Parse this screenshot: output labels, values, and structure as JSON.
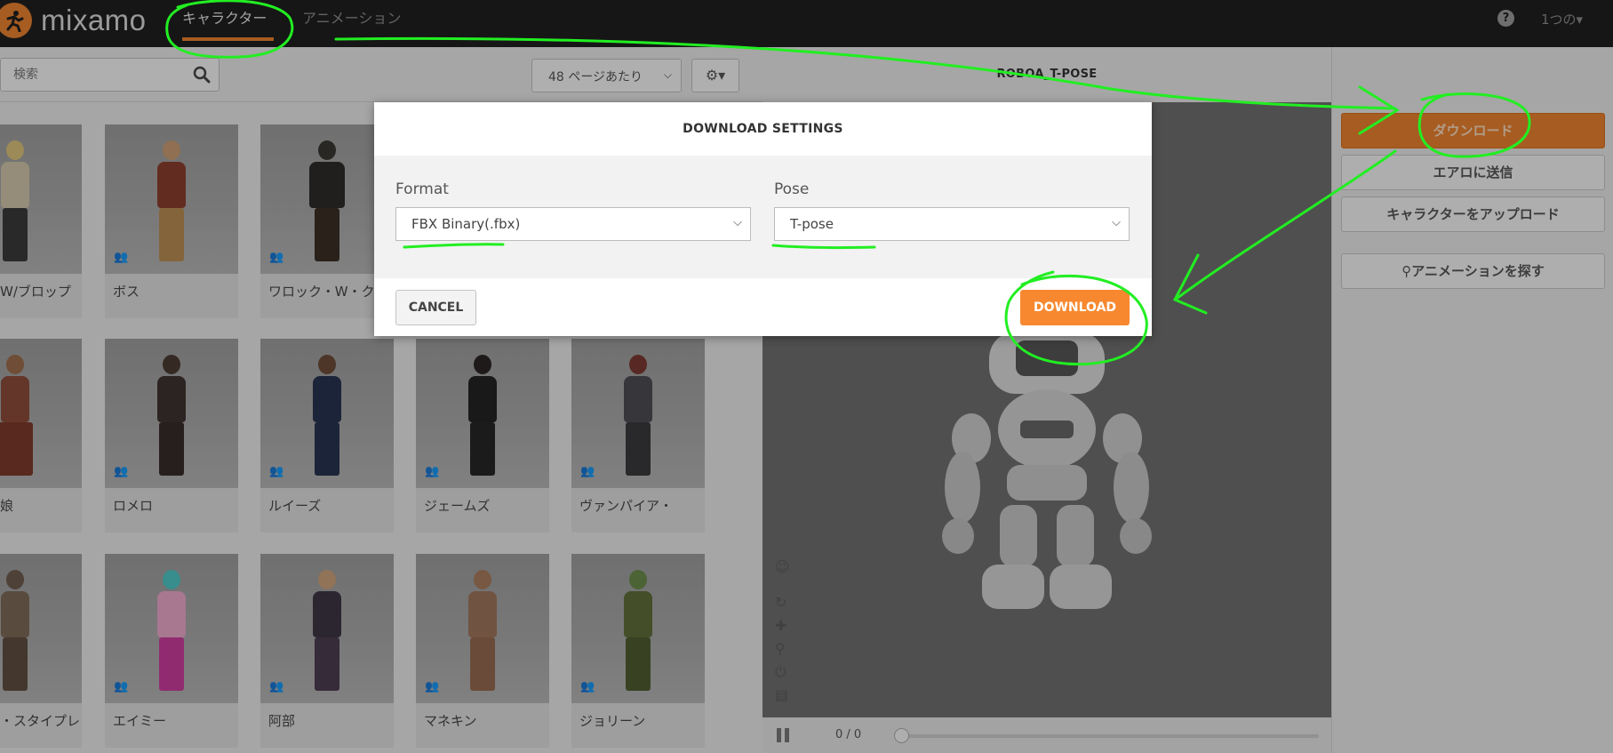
{
  "header": {
    "logo_text": "mixamo",
    "tabs": [
      {
        "label": "キャラクター",
        "active": true
      },
      {
        "label": "アニメーション",
        "active": false
      }
    ],
    "help_symbol": "?",
    "user_menu": "1つの▾"
  },
  "library": {
    "search_placeholder": "検索",
    "per_page": "48 ページあたり",
    "gear_label": "⚙▾",
    "cards": [
      {
        "name": "W/ブロップ"
      },
      {
        "name": "ボス"
      },
      {
        "name": "ワロック・W・ク"
      },
      {
        "name": "娘"
      },
      {
        "name": "ロメロ"
      },
      {
        "name": "ルイーズ"
      },
      {
        "name": "ジェームズ"
      },
      {
        "name": "ヴァンパイア・"
      },
      {
        "name": "・スタイプレ"
      },
      {
        "name": "エイミー"
      },
      {
        "name": "阿部"
      },
      {
        "name": "マネキン"
      },
      {
        "name": "ジョリーン"
      }
    ]
  },
  "viewer": {
    "title": "ROBOA_T-POSE",
    "frame_count": "0 / 0"
  },
  "actions": {
    "download": "ダウンロード",
    "send_to_aero": "エアロに送信",
    "upload_character": "キャラクターをアップロード",
    "find_animations": "アニメーションを探す"
  },
  "modal": {
    "title": "DOWNLOAD SETTINGS",
    "format_label": "Format",
    "format_value": "FBX Binary(.fbx)",
    "pose_label": "Pose",
    "pose_value": "T-pose",
    "cancel": "CANCEL",
    "download": "DOWNLOAD"
  },
  "colors": {
    "accent_orange": "#e8802f",
    "download_orange": "#f7882f",
    "annotation_green": "#22ee22",
    "topbar": "#1f1f1f"
  }
}
